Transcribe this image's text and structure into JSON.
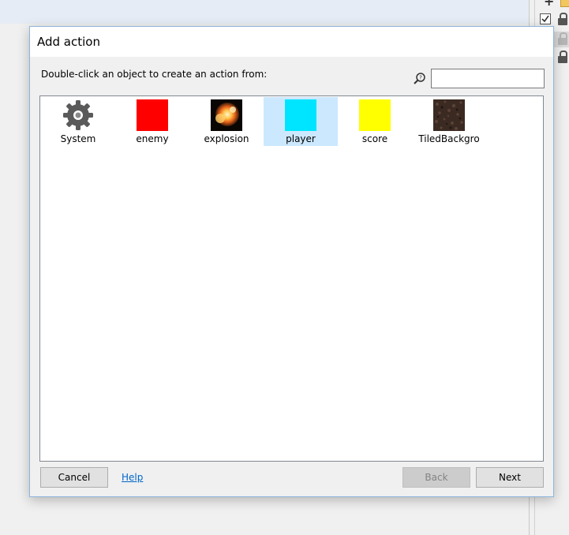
{
  "dialog": {
    "title": "Add action",
    "instruction": "Double-click an object to create an action from:",
    "search": {
      "value": "",
      "placeholder": ""
    },
    "objects": [
      {
        "label": "System",
        "icon": "gear-icon",
        "color": "#5a5a5a",
        "selected": false
      },
      {
        "label": "enemy",
        "icon": "red-square-sprite",
        "color": "#ff0000",
        "selected": false
      },
      {
        "label": "explosion",
        "icon": "explosion-sprite",
        "color": "#f5a623",
        "selected": false
      },
      {
        "label": "player",
        "icon": "cyan-square-sprite",
        "color": "#00e5ff",
        "selected": true
      },
      {
        "label": "score",
        "icon": "yellow-square-sprite",
        "color": "#ffff00",
        "selected": false
      },
      {
        "label": "TiledBackgro",
        "icon": "tiled-background-texture",
        "color": "#3b2a22",
        "selected": false
      }
    ],
    "buttons": {
      "cancel": "Cancel",
      "help": "Help",
      "back": "Back",
      "next": "Next"
    }
  }
}
